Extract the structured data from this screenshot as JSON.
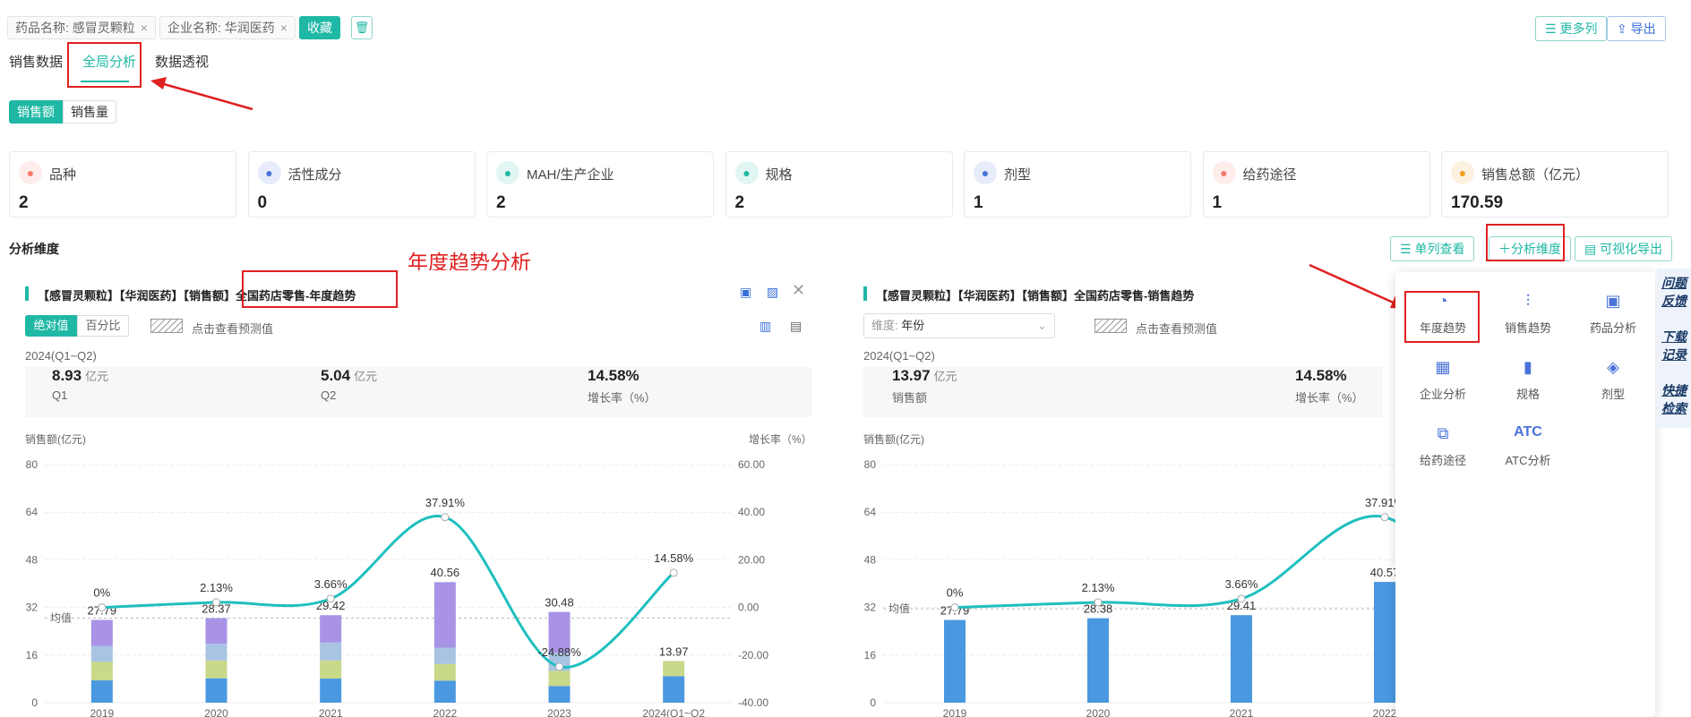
{
  "filters": [
    {
      "label": "药品名称: 感冒灵颗粒"
    },
    {
      "label": "企业名称: 华润医药"
    }
  ],
  "toolbar": {
    "collect": "收藏",
    "more_cols": "更多列",
    "export": "导出"
  },
  "tabs": [
    "销售数据",
    "全局分析",
    "数据透视"
  ],
  "metric_toggle": [
    "销售额",
    "销售量"
  ],
  "cards": [
    {
      "label": "品种",
      "value": "2",
      "icon": "variety-icon",
      "color": "#f47a6b"
    },
    {
      "label": "活性成分",
      "value": "0",
      "icon": "molecule-icon",
      "color": "#4a73d9"
    },
    {
      "label": "MAH/生产企业",
      "value": "2",
      "icon": "factory-icon",
      "color": "#1fb8a5"
    },
    {
      "label": "规格",
      "value": "2",
      "icon": "spec-icon",
      "color": "#1fb8a5"
    },
    {
      "label": "剂型",
      "value": "1",
      "icon": "dosage-icon",
      "color": "#4a73d9"
    },
    {
      "label": "给药途径",
      "value": "1",
      "icon": "route-icon",
      "color": "#f47a6b"
    },
    {
      "label": "销售总额（亿元）",
      "value": "170.59",
      "icon": "money-icon",
      "color": "#f0a020"
    }
  ],
  "section": {
    "title": "分析维度",
    "single_col": "单列查看",
    "add_dim": "分析维度",
    "vis_export": "可视化导出"
  },
  "annotation": {
    "text": "年度趋势分析"
  },
  "panel_left": {
    "title": "【感冒灵颗粒】【华润医药】【销售额】全国药店零售-年度趋势",
    "toggle": [
      "绝对值",
      "百分比"
    ],
    "forecast": "点击查看预测值",
    "period": "2024(Q1~Q2)",
    "stats": [
      {
        "value": "8.93",
        "unit": "亿元",
        "label": "Q1"
      },
      {
        "value": "5.04",
        "unit": "亿元",
        "label": "Q2"
      },
      {
        "value": "14.58%",
        "unit": "",
        "label": "增长率（%）"
      }
    ],
    "ylabel": "销售额(亿元)",
    "y2label": "增长率（%）",
    "avg": "均值"
  },
  "panel_right": {
    "title": "【感冒灵颗粒】【华润医药】【销售额】全国药店零售-销售趋势",
    "dim_label": "维度:",
    "dim_value": "年份",
    "forecast": "点击查看预测值",
    "period": "2024(Q1~Q2)",
    "stats": [
      {
        "value": "13.97",
        "unit": "亿元",
        "label": "销售额"
      },
      {
        "value": "14.58%",
        "unit": "",
        "label": "增长率（%）"
      }
    ],
    "ylabel": "销售额(亿元)",
    "avg": "均值"
  },
  "dropdown": [
    {
      "label": "年度趋势",
      "icon": "trend-chart-icon"
    },
    {
      "label": "销售趋势",
      "icon": "sales-trend-icon"
    },
    {
      "label": "药品分析",
      "icon": "drug-analysis-icon"
    },
    {
      "label": "企业分析",
      "icon": "enterprise-icon"
    },
    {
      "label": "规格",
      "icon": "spec-icon"
    },
    {
      "label": "剂型",
      "icon": "dosage-icon"
    },
    {
      "label": "给药途径",
      "icon": "route-icon"
    },
    {
      "label": "ATC分析",
      "icon": "atc-icon"
    }
  ],
  "side": [
    "问题反馈",
    "下载记录",
    "快捷检索"
  ],
  "chart_data": [
    {
      "type": "bar",
      "title": "",
      "categories": [
        "2019",
        "2020",
        "2021",
        "2022",
        "2023",
        "2024(Q1~Q2"
      ],
      "stacked_values": [
        [
          7.5,
          6.2,
          5.3,
          8.8
        ],
        [
          8.2,
          6.0,
          5.6,
          8.6
        ],
        [
          8.1,
          6.1,
          6.0,
          9.2
        ],
        [
          7.4,
          5.6,
          5.5,
          22.0
        ],
        [
          5.6,
          5.1,
          6.1,
          13.7
        ],
        [
          8.9,
          5.1
        ]
      ],
      "totals": [
        "27.79",
        "28.37",
        "29.42",
        "40.56",
        "30.48",
        "13.97"
      ],
      "series": [
        {
          "name": "",
          "values": [
            27.79,
            28.37,
            29.42,
            40.56,
            30.48,
            13.97
          ]
        }
      ],
      "growth": [
        0,
        2.13,
        3.66,
        37.91,
        -24.88,
        14.58
      ],
      "growth_labels": [
        "0%",
        "2.13%",
        "3.66%",
        "37.91%",
        "-24.88%",
        "14.58%"
      ],
      "y_ticks": [
        "0",
        "16",
        "32",
        "48",
        "64",
        "80"
      ],
      "ylim": [
        0,
        80
      ],
      "y2_ticks": [
        "-40.00",
        "-20.00",
        "0.00",
        "20.00",
        "40.00",
        "60.00"
      ],
      "y2lim": [
        -40,
        60
      ],
      "colors": [
        "#4a98e0",
        "#c9d98a",
        "#a8c4e2",
        "#a893e6",
        "#1fbfbf"
      ]
    },
    {
      "type": "bar",
      "title": "",
      "categories": [
        "2019",
        "2020",
        "2021",
        "2022"
      ],
      "series": [
        {
          "name": "",
          "values": [
            27.79,
            28.38,
            29.41,
            40.57
          ]
        }
      ],
      "labels": [
        "27.79",
        "28.38",
        "29.41",
        "40.57"
      ],
      "growth": [
        0,
        2.13,
        3.66,
        37.91
      ],
      "growth_labels": [
        "0%",
        "2.13%",
        "3.66%",
        "37.91%"
      ],
      "y_ticks": [
        "0",
        "16",
        "32",
        "48",
        "64",
        "80"
      ],
      "ylim": [
        0,
        80
      ]
    }
  ]
}
